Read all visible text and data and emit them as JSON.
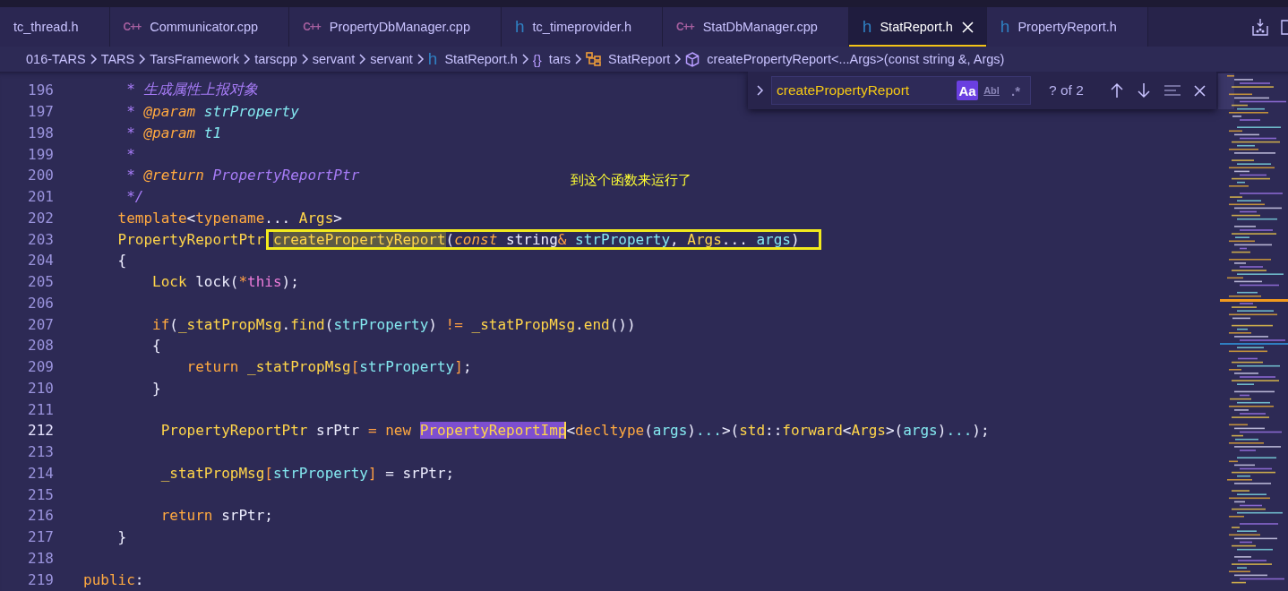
{
  "tabs": [
    {
      "label": "tc_thread.h",
      "selected": false
    },
    {
      "label": "Communicator.cpp",
      "kind": "cpp",
      "icon": "C++",
      "selected": false
    },
    {
      "label": "PropertyDbManager.cpp",
      "kind": "cpp",
      "icon": "C++",
      "selected": false
    },
    {
      "label": "tc_timeprovider.h",
      "kind": "h",
      "icon": "h",
      "selected": false
    },
    {
      "label": "StatDbManager.cpp",
      "kind": "cpp",
      "icon": "C++",
      "selected": false
    },
    {
      "label": "StatReport.h",
      "kind": "h",
      "icon": "h",
      "selected": true
    },
    {
      "label": "PropertyReport.h",
      "kind": "h",
      "icon": "h",
      "selected": false
    }
  ],
  "breadcrumb": [
    {
      "label": "016-TARS",
      "kind": "folder"
    },
    {
      "label": "TARS",
      "kind": "folder"
    },
    {
      "label": "TarsFramework",
      "kind": "folder"
    },
    {
      "label": "tarscpp",
      "kind": "folder"
    },
    {
      "label": "servant",
      "kind": "folder"
    },
    {
      "label": "servant",
      "kind": "folder"
    },
    {
      "label": "StatReport.h",
      "kind": "file",
      "icon": "h"
    },
    {
      "label": "tars",
      "kind": "namespace",
      "icon": "{}"
    },
    {
      "label": "StatReport",
      "kind": "class"
    },
    {
      "label": "createPropertyReport<...Args>(const string &, Args)",
      "kind": "method"
    }
  ],
  "find": {
    "replace_expanded": false,
    "value": "createPropertyReport",
    "options": [
      {
        "label": "Aa",
        "on": true
      },
      {
        "label": "Abl",
        "on": false
      },
      {
        "label": ".*",
        "on": false
      }
    ],
    "count": "? of 2"
  },
  "annotation": "到这个函数来运行了",
  "lines": [
    {
      "number": "196",
      "current": false,
      "tokens": [
        {
          "text": "     * 生成属性上报对象",
          "kind": "comment"
        }
      ]
    },
    {
      "number": "197",
      "current": false,
      "tokens": [
        {
          "text": "     * ",
          "kind": "comment"
        },
        {
          "text": "@param",
          "kind": "doctag"
        },
        {
          "text": " strProperty",
          "kind": "docparam"
        }
      ]
    },
    {
      "number": "198",
      "current": false,
      "tokens": [
        {
          "text": "     * ",
          "kind": "comment"
        },
        {
          "text": "@param",
          "kind": "doctag"
        },
        {
          "text": " t1",
          "kind": "docparam"
        }
      ]
    },
    {
      "number": "199",
      "current": false,
      "tokens": [
        {
          "text": "     *",
          "kind": "comment"
        }
      ]
    },
    {
      "number": "200",
      "current": false,
      "tokens": [
        {
          "text": "     * ",
          "kind": "comment"
        },
        {
          "text": "@return",
          "kind": "doctag"
        },
        {
          "text": " PropertyReportPtr",
          "kind": "comment"
        }
      ]
    },
    {
      "number": "201",
      "current": false,
      "tokens": [
        {
          "text": "     */",
          "kind": "comment"
        }
      ]
    },
    {
      "number": "202",
      "current": false,
      "tokens": [
        {
          "text": "    template",
          "kind": "kw"
        },
        {
          "text": "<",
          "kind": "plain"
        },
        {
          "text": "typename",
          "kind": "kw"
        },
        {
          "text": "... ",
          "kind": "plain"
        },
        {
          "text": "Args",
          "kind": "type"
        },
        {
          "text": ">",
          "kind": "plain"
        }
      ]
    },
    {
      "number": "203",
      "current": false,
      "tokens": [
        {
          "text": "    PropertyReportPtr ",
          "kind": "type"
        }
      ],
      "boxed_tokens": [
        {
          "text": "createPropertyReport",
          "kind": "fn",
          "match": true
        },
        {
          "text": "(",
          "kind": "plain"
        },
        {
          "text": "const",
          "kind": "kwi"
        },
        {
          "text": " string",
          "kind": "plain"
        },
        {
          "text": "&",
          "kind": "op"
        },
        {
          "text": " strProperty",
          "kind": "param"
        },
        {
          "text": ", ",
          "kind": "plain"
        },
        {
          "text": "Args",
          "kind": "type"
        },
        {
          "text": "... ",
          "kind": "plain"
        },
        {
          "text": "args",
          "kind": "param"
        },
        {
          "text": ")",
          "kind": "plain"
        }
      ]
    },
    {
      "number": "204",
      "current": false,
      "tokens": [
        {
          "text": "    {",
          "kind": "plain"
        }
      ]
    },
    {
      "number": "205",
      "current": false,
      "tokens": [
        {
          "text": "        Lock",
          "kind": "type"
        },
        {
          "text": " lock(",
          "kind": "plain"
        },
        {
          "text": "*",
          "kind": "op"
        },
        {
          "text": "this",
          "kind": "this"
        },
        {
          "text": ");",
          "kind": "plain"
        }
      ]
    },
    {
      "number": "206",
      "current": false
    },
    {
      "number": "207",
      "current": false,
      "tokens": [
        {
          "text": "        if",
          "kind": "kw"
        },
        {
          "text": "(",
          "kind": "plain"
        },
        {
          "text": "_statPropMsg",
          "kind": "type"
        },
        {
          "text": ".",
          "kind": "plain"
        },
        {
          "text": "find",
          "kind": "fn"
        },
        {
          "text": "(",
          "kind": "plain"
        },
        {
          "text": "strProperty",
          "kind": "param"
        },
        {
          "text": ") ",
          "kind": "plain"
        },
        {
          "text": "!=",
          "kind": "op"
        },
        {
          "text": " _statPropMsg",
          "kind": "type"
        },
        {
          "text": ".",
          "kind": "plain"
        },
        {
          "text": "end",
          "kind": "fn"
        },
        {
          "text": "())",
          "kind": "plain"
        }
      ]
    },
    {
      "number": "208",
      "current": false,
      "tokens": [
        {
          "text": "        {",
          "kind": "plain"
        }
      ]
    },
    {
      "number": "209",
      "current": false,
      "tokens": [
        {
          "text": "            return",
          "kind": "kw"
        },
        {
          "text": " _statPropMsg",
          "kind": "type"
        },
        {
          "text": "[",
          "kind": "op"
        },
        {
          "text": "strProperty",
          "kind": "param"
        },
        {
          "text": "]",
          "kind": "op"
        },
        {
          "text": ";",
          "kind": "plain"
        }
      ]
    },
    {
      "number": "210",
      "current": false,
      "tokens": [
        {
          "text": "        }",
          "kind": "plain"
        }
      ]
    },
    {
      "number": "211",
      "current": false
    },
    {
      "number": "212",
      "current": true,
      "tokens": [
        {
          "text": "         PropertyReportPtr",
          "kind": "type"
        },
        {
          "text": " srPtr ",
          "kind": "plain"
        },
        {
          "text": "=",
          "kind": "op"
        },
        {
          "text": " new ",
          "kind": "kw"
        },
        {
          "text": "PropertyReportImp",
          "kind": "type",
          "selected": true,
          "cursor": true
        },
        {
          "text": "<",
          "kind": "plain"
        },
        {
          "text": "decltype",
          "kind": "kw"
        },
        {
          "text": "(",
          "kind": "plain"
        },
        {
          "text": "args",
          "kind": "param"
        },
        {
          "text": ")",
          "kind": "plain"
        },
        {
          "text": "...",
          "kind": "param"
        },
        {
          "text": ">(",
          "kind": "plain"
        },
        {
          "text": "std",
          "kind": "type"
        },
        {
          "text": "::",
          "kind": "plain"
        },
        {
          "text": "forward",
          "kind": "fn"
        },
        {
          "text": "<",
          "kind": "plain"
        },
        {
          "text": "Args",
          "kind": "type"
        },
        {
          "text": ">(",
          "kind": "plain"
        },
        {
          "text": "args",
          "kind": "param"
        },
        {
          "text": ")",
          "kind": "plain"
        },
        {
          "text": "...",
          "kind": "param"
        },
        {
          "text": ");",
          "kind": "plain"
        }
      ]
    },
    {
      "number": "213",
      "current": false
    },
    {
      "number": "214",
      "current": false,
      "tokens": [
        {
          "text": "         _statPropMsg",
          "kind": "type"
        },
        {
          "text": "[",
          "kind": "op"
        },
        {
          "text": "strProperty",
          "kind": "param"
        },
        {
          "text": "]",
          "kind": "op"
        },
        {
          "text": " = srPtr;",
          "kind": "plain"
        }
      ]
    },
    {
      "number": "215",
      "current": false
    },
    {
      "number": "216",
      "current": false,
      "tokens": [
        {
          "text": "         return",
          "kind": "kw"
        },
        {
          "text": " srPtr;",
          "kind": "plain"
        }
      ]
    },
    {
      "number": "217",
      "current": false,
      "tokens": [
        {
          "text": "    }",
          "kind": "plain"
        }
      ]
    },
    {
      "number": "218",
      "current": false
    },
    {
      "number": "219",
      "current": false,
      "tokens": [
        {
          "text": "public",
          "kind": "kw"
        },
        {
          "text": ":",
          "kind": "plain"
        }
      ]
    }
  ]
}
